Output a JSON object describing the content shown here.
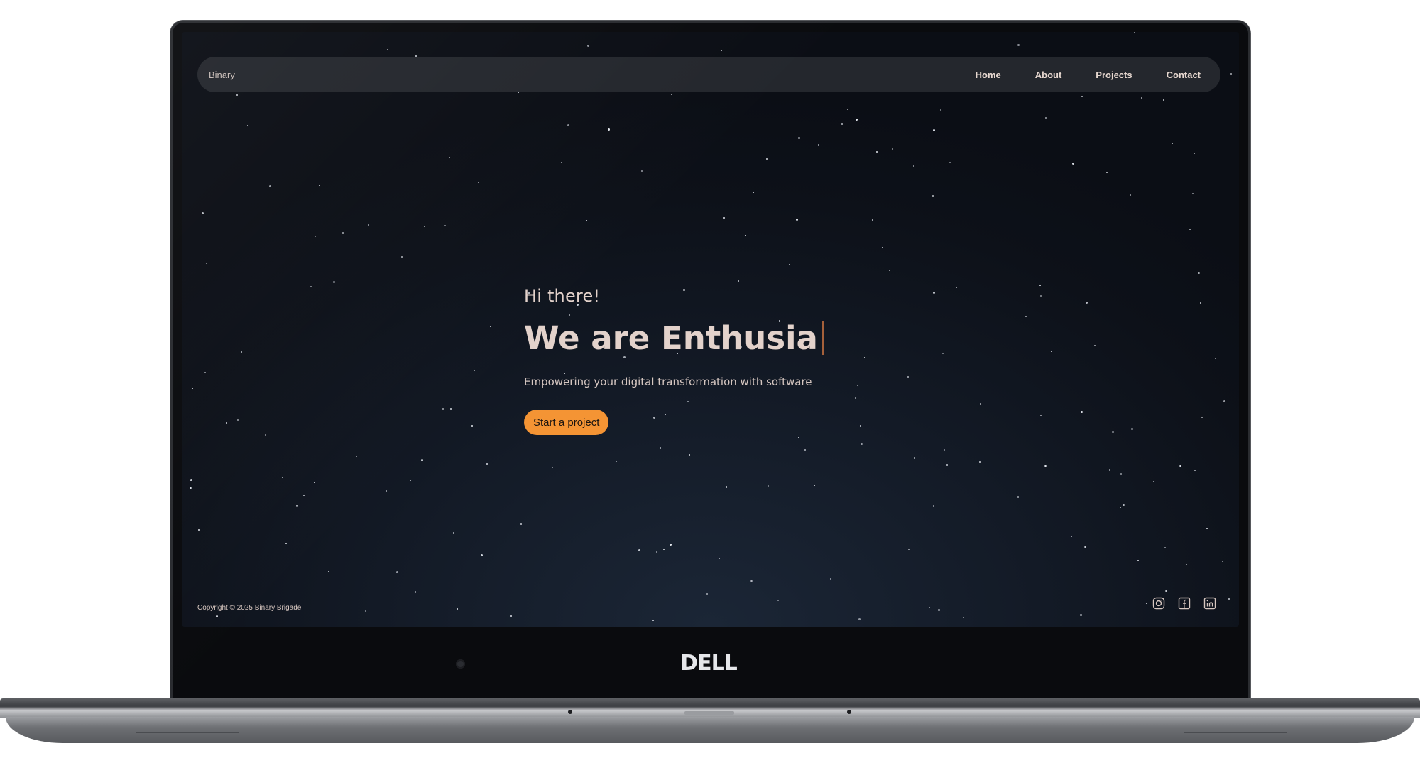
{
  "navbar": {
    "brand": "Binary",
    "links": [
      "Home",
      "About",
      "Projects",
      "Contact"
    ]
  },
  "hero": {
    "greeting": "Hi there!",
    "headline": "We are Enthusia",
    "tagline": "Empowering your digital transformation with software",
    "cta_label": "Start a project"
  },
  "footer": {
    "copyright": "Copyright © 2025 Binary Brigade",
    "socials": [
      "instagram-icon",
      "facebook-icon",
      "linkedin-icon"
    ]
  },
  "device": {
    "logo": "DELL"
  },
  "colors": {
    "accent": "#f49434",
    "text": "#e3d2cb",
    "navbar_bg": "#24272d",
    "sky_dark": "#0b0e15",
    "sky_light": "#1b2636"
  }
}
